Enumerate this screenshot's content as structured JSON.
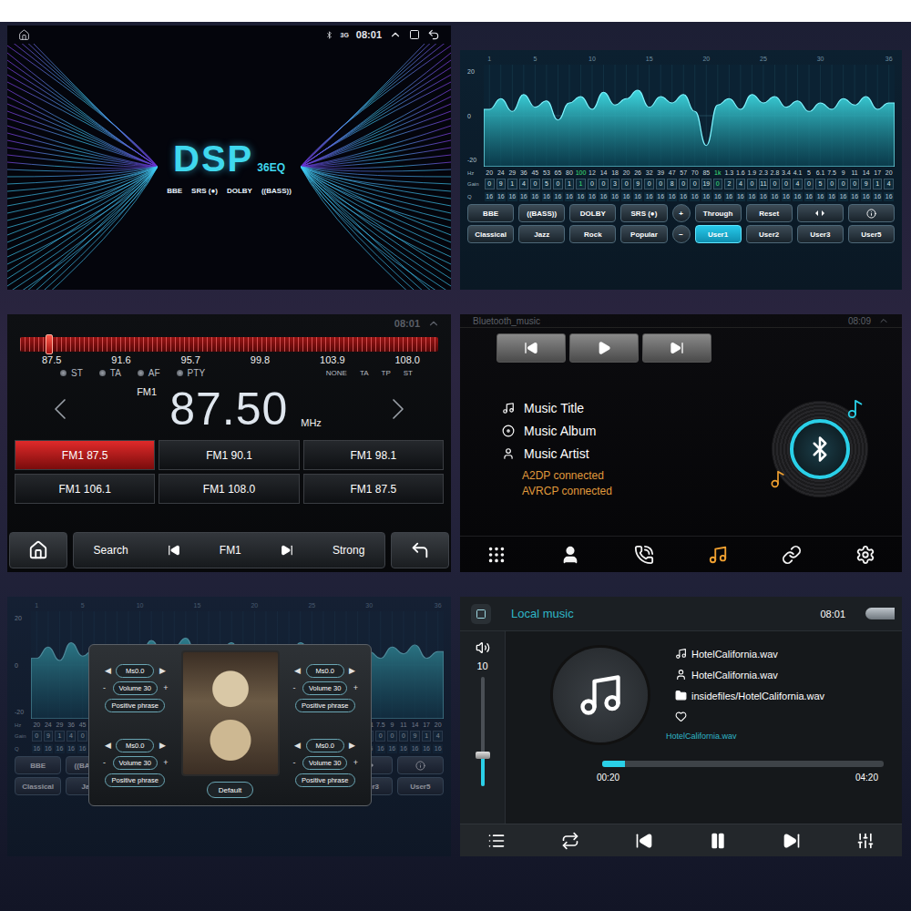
{
  "splash": {
    "time": "08:01",
    "network": "3G",
    "title": "DSP",
    "subtitle": "36EQ",
    "badges": [
      "BBE",
      "SRS (●)",
      "DOLBY",
      "((BASS))"
    ]
  },
  "eq": {
    "x_ticks": [
      "1",
      "5",
      "10",
      "15",
      "20",
      "25",
      "30",
      "36"
    ],
    "y_ticks": [
      "20",
      "0",
      "-20"
    ],
    "row_labels": {
      "hz": "Hz",
      "gain": "Gain",
      "q": "Q"
    },
    "bands": [
      {
        "hz": "20",
        "gain": "0",
        "q": "16",
        "highlight": false
      },
      {
        "hz": "24",
        "gain": "9",
        "q": "16",
        "highlight": false
      },
      {
        "hz": "29",
        "gain": "1",
        "q": "16",
        "highlight": false
      },
      {
        "hz": "36",
        "gain": "4",
        "q": "16",
        "highlight": false
      },
      {
        "hz": "45",
        "gain": "0",
        "q": "16",
        "highlight": false
      },
      {
        "hz": "53",
        "gain": "5",
        "q": "16",
        "highlight": false
      },
      {
        "hz": "65",
        "gain": "0",
        "q": "16",
        "highlight": false
      },
      {
        "hz": "80",
        "gain": "1",
        "q": "16",
        "highlight": false
      },
      {
        "hz": "100",
        "gain": "1",
        "q": "16",
        "highlight": true
      },
      {
        "hz": "12",
        "gain": "0",
        "q": "16",
        "highlight": false
      },
      {
        "hz": "14",
        "gain": "0",
        "q": "16",
        "highlight": false
      },
      {
        "hz": "18",
        "gain": "3",
        "q": "16",
        "highlight": false
      },
      {
        "hz": "20",
        "gain": "0",
        "q": "16",
        "highlight": false
      },
      {
        "hz": "26",
        "gain": "9",
        "q": "16",
        "highlight": false
      },
      {
        "hz": "32",
        "gain": "0",
        "q": "16",
        "highlight": false
      },
      {
        "hz": "39",
        "gain": "0",
        "q": "16",
        "highlight": false
      },
      {
        "hz": "47",
        "gain": "8",
        "q": "16",
        "highlight": false
      },
      {
        "hz": "57",
        "gain": "0",
        "q": "16",
        "highlight": false
      },
      {
        "hz": "70",
        "gain": "0",
        "q": "16",
        "highlight": false
      },
      {
        "hz": "85",
        "gain": "19",
        "q": "16",
        "highlight": false
      },
      {
        "hz": "1k",
        "gain": "0",
        "q": "16",
        "highlight": true
      },
      {
        "hz": "1.3",
        "gain": "2",
        "q": "16",
        "highlight": false
      },
      {
        "hz": "1.6",
        "gain": "4",
        "q": "16",
        "highlight": false
      },
      {
        "hz": "1.9",
        "gain": "0",
        "q": "16",
        "highlight": false
      },
      {
        "hz": "2.3",
        "gain": "11",
        "q": "16",
        "highlight": false
      },
      {
        "hz": "2.8",
        "gain": "0",
        "q": "16",
        "highlight": false
      },
      {
        "hz": "3.4",
        "gain": "0",
        "q": "16",
        "highlight": false
      },
      {
        "hz": "4.1",
        "gain": "4",
        "q": "16",
        "highlight": false
      },
      {
        "hz": "5",
        "gain": "0",
        "q": "16",
        "highlight": false
      },
      {
        "hz": "6.1",
        "gain": "5",
        "q": "16",
        "highlight": false
      },
      {
        "hz": "7.5",
        "gain": "0",
        "q": "16",
        "highlight": false
      },
      {
        "hz": "9",
        "gain": "0",
        "q": "16",
        "highlight": false
      },
      {
        "hz": "11",
        "gain": "0",
        "q": "16",
        "highlight": false
      },
      {
        "hz": "14",
        "gain": "9",
        "q": "16",
        "highlight": false
      },
      {
        "hz": "17",
        "gain": "1",
        "q": "16",
        "highlight": false
      },
      {
        "hz": "20",
        "gain": "4",
        "q": "16",
        "highlight": false
      }
    ],
    "curve": [
      3,
      8,
      2,
      10,
      4,
      7,
      -2,
      6,
      9,
      3,
      11,
      5,
      8,
      12,
      4,
      9,
      6,
      10,
      2,
      -14,
      5,
      8,
      3,
      10,
      6,
      9,
      4,
      7,
      2,
      6,
      3,
      8,
      5,
      9,
      3,
      6
    ],
    "effect_buttons": [
      {
        "label": "BBE",
        "kind": "text",
        "selected": false
      },
      {
        "label": "((BASS))",
        "kind": "text",
        "selected": false
      },
      {
        "label": "DOLBY",
        "kind": "text",
        "selected": false
      },
      {
        "label": "SRS (●)",
        "kind": "text",
        "selected": false
      },
      {
        "label": "+",
        "kind": "round",
        "selected": false
      },
      {
        "label": "Through",
        "kind": "text",
        "selected": false
      },
      {
        "label": "Reset",
        "kind": "text",
        "selected": false
      },
      {
        "label": "",
        "kind": "balance",
        "selected": false
      },
      {
        "label": "",
        "kind": "info",
        "selected": false
      }
    ],
    "preset_buttons": [
      {
        "label": "Classical",
        "kind": "text",
        "selected": false
      },
      {
        "label": "Jazz",
        "kind": "text",
        "selected": false
      },
      {
        "label": "Rock",
        "kind": "text",
        "selected": false
      },
      {
        "label": "Popular",
        "kind": "text",
        "selected": false
      },
      {
        "label": "−",
        "kind": "round",
        "selected": false
      },
      {
        "label": "User1",
        "kind": "text",
        "selected": true
      },
      {
        "label": "User2",
        "kind": "text",
        "selected": false
      },
      {
        "label": "User3",
        "kind": "text",
        "selected": false
      },
      {
        "label": "User5",
        "kind": "text",
        "selected": false
      }
    ]
  },
  "radio": {
    "time": "08:01",
    "scale": [
      "87.5",
      "91.6",
      "95.7",
      "99.8",
      "103.9",
      "108.0"
    ],
    "tuner_level": 0.07,
    "indicators_left": [
      "ST",
      "TA",
      "AF",
      "PTY"
    ],
    "indicators_right": [
      "NONE",
      "TA",
      "TP",
      "ST"
    ],
    "band": "FM1",
    "frequency": "87.50",
    "unit": "MHz",
    "presets": [
      {
        "label": "FM1 87.5",
        "selected": true
      },
      {
        "label": "FM1 90.1",
        "selected": false
      },
      {
        "label": "FM1 98.1",
        "selected": false
      },
      {
        "label": "FM1 106.1",
        "selected": false
      },
      {
        "label": "FM1 108.0",
        "selected": false
      },
      {
        "label": "FM1 87.5",
        "selected": false
      }
    ],
    "controls": {
      "search": "Search",
      "band": "FM1",
      "signal": "Strong"
    }
  },
  "bluetooth": {
    "header": "Bluetooth_music",
    "time": "08:09",
    "info": [
      {
        "label": "Music Title",
        "kind": "title"
      },
      {
        "label": "Music Album",
        "kind": "album"
      },
      {
        "label": "Music Artist",
        "kind": "artist"
      }
    ],
    "status": [
      "A2DP connected",
      "AVRCP connected"
    ],
    "nav": [
      {
        "kind": "dialpad",
        "selected": false
      },
      {
        "kind": "contacts",
        "selected": false
      },
      {
        "kind": "calls",
        "selected": false
      },
      {
        "kind": "music",
        "selected": true
      },
      {
        "kind": "pairing",
        "selected": false
      },
      {
        "kind": "settings",
        "selected": false
      }
    ]
  },
  "speaker_setup": {
    "arrows": {
      "left": "◀",
      "right": "▶",
      "minus": "-",
      "plus": "+"
    },
    "channels": [
      {
        "delay": "Ms0.0",
        "volume": "Volume 30",
        "phase": "Positive phrase"
      },
      {
        "delay": "Ms0.0",
        "volume": "Volume 30",
        "phase": "Positive phrase"
      },
      {
        "delay": "Ms0.0",
        "volume": "Volume 30",
        "phase": "Positive phrase"
      },
      {
        "delay": "Ms0.0",
        "volume": "Volume 30",
        "phase": "Positive phrase"
      }
    ],
    "default_button": "Default"
  },
  "local_music": {
    "title": "Local music",
    "time": "08:01",
    "volume": "10",
    "volume_level": 0.28,
    "track": "HotelCalifornia.wav",
    "artist": "HotelCalifornia.wav",
    "path": "insidefiles/HotelCalifornia.wav",
    "favorite": false,
    "now_playing": "HotelCalifornia.wav",
    "elapsed": "00:20",
    "total": "04:20",
    "progress": 0.08,
    "playing": true
  }
}
